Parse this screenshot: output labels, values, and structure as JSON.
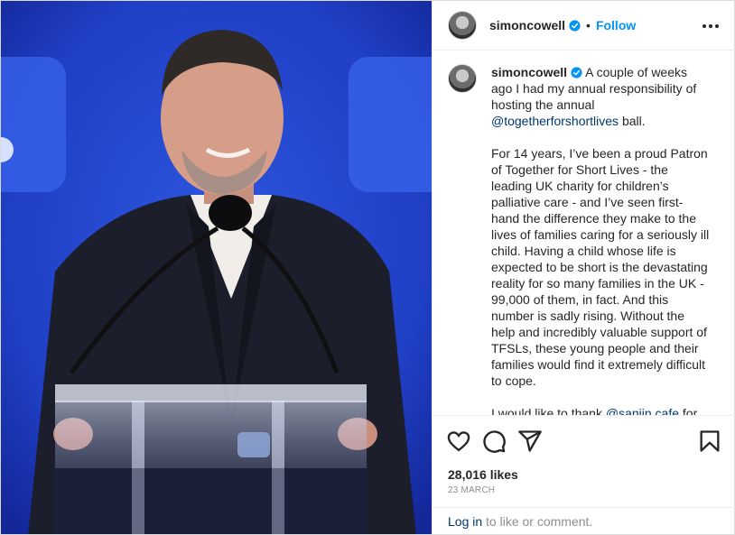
{
  "colors": {
    "accent": "#0095f6",
    "mention": "#00376b",
    "verified": "#0095f6",
    "stage_blue": "#1f3fc4"
  },
  "header": {
    "username": "simoncowell",
    "separator": "•",
    "follow_label": "Follow",
    "more_icon": "more-horizontal-icon"
  },
  "caption": {
    "username": "simoncowell",
    "paragraph1_before": "A couple of weeks ago I had my annual responsibility of hosting the annual ",
    "paragraph1_mention": "@togetherforshortlives",
    "paragraph1_after": " ball.",
    "paragraph2": "For 14 years, I’ve been a proud Patron of Together for Short Lives - the leading UK charity for children’s palliative care - and I’ve seen first-hand the difference they make to the lives of families caring for a seriously ill child. Having a child whose life is expected to be short is the devastating reality for so many families in the UK - 99,000 of them, in fact. And this number is sadly rising. Without the help and incredibly valuable support of TFSLs, these young people and their families would find it extremely difficult to cope.",
    "paragraph3_before": "I would like to thank ",
    "paragraph3_mention": "@sanjin.cafe",
    "paragraph3_after": " for"
  },
  "actions": {
    "icons": [
      "heart-icon",
      "comment-icon",
      "share-icon",
      "bookmark-icon"
    ]
  },
  "likes_text": "28,016 likes",
  "date_text": "23 MARCH",
  "login": {
    "link_label": "Log in",
    "rest": " to like or comment."
  }
}
